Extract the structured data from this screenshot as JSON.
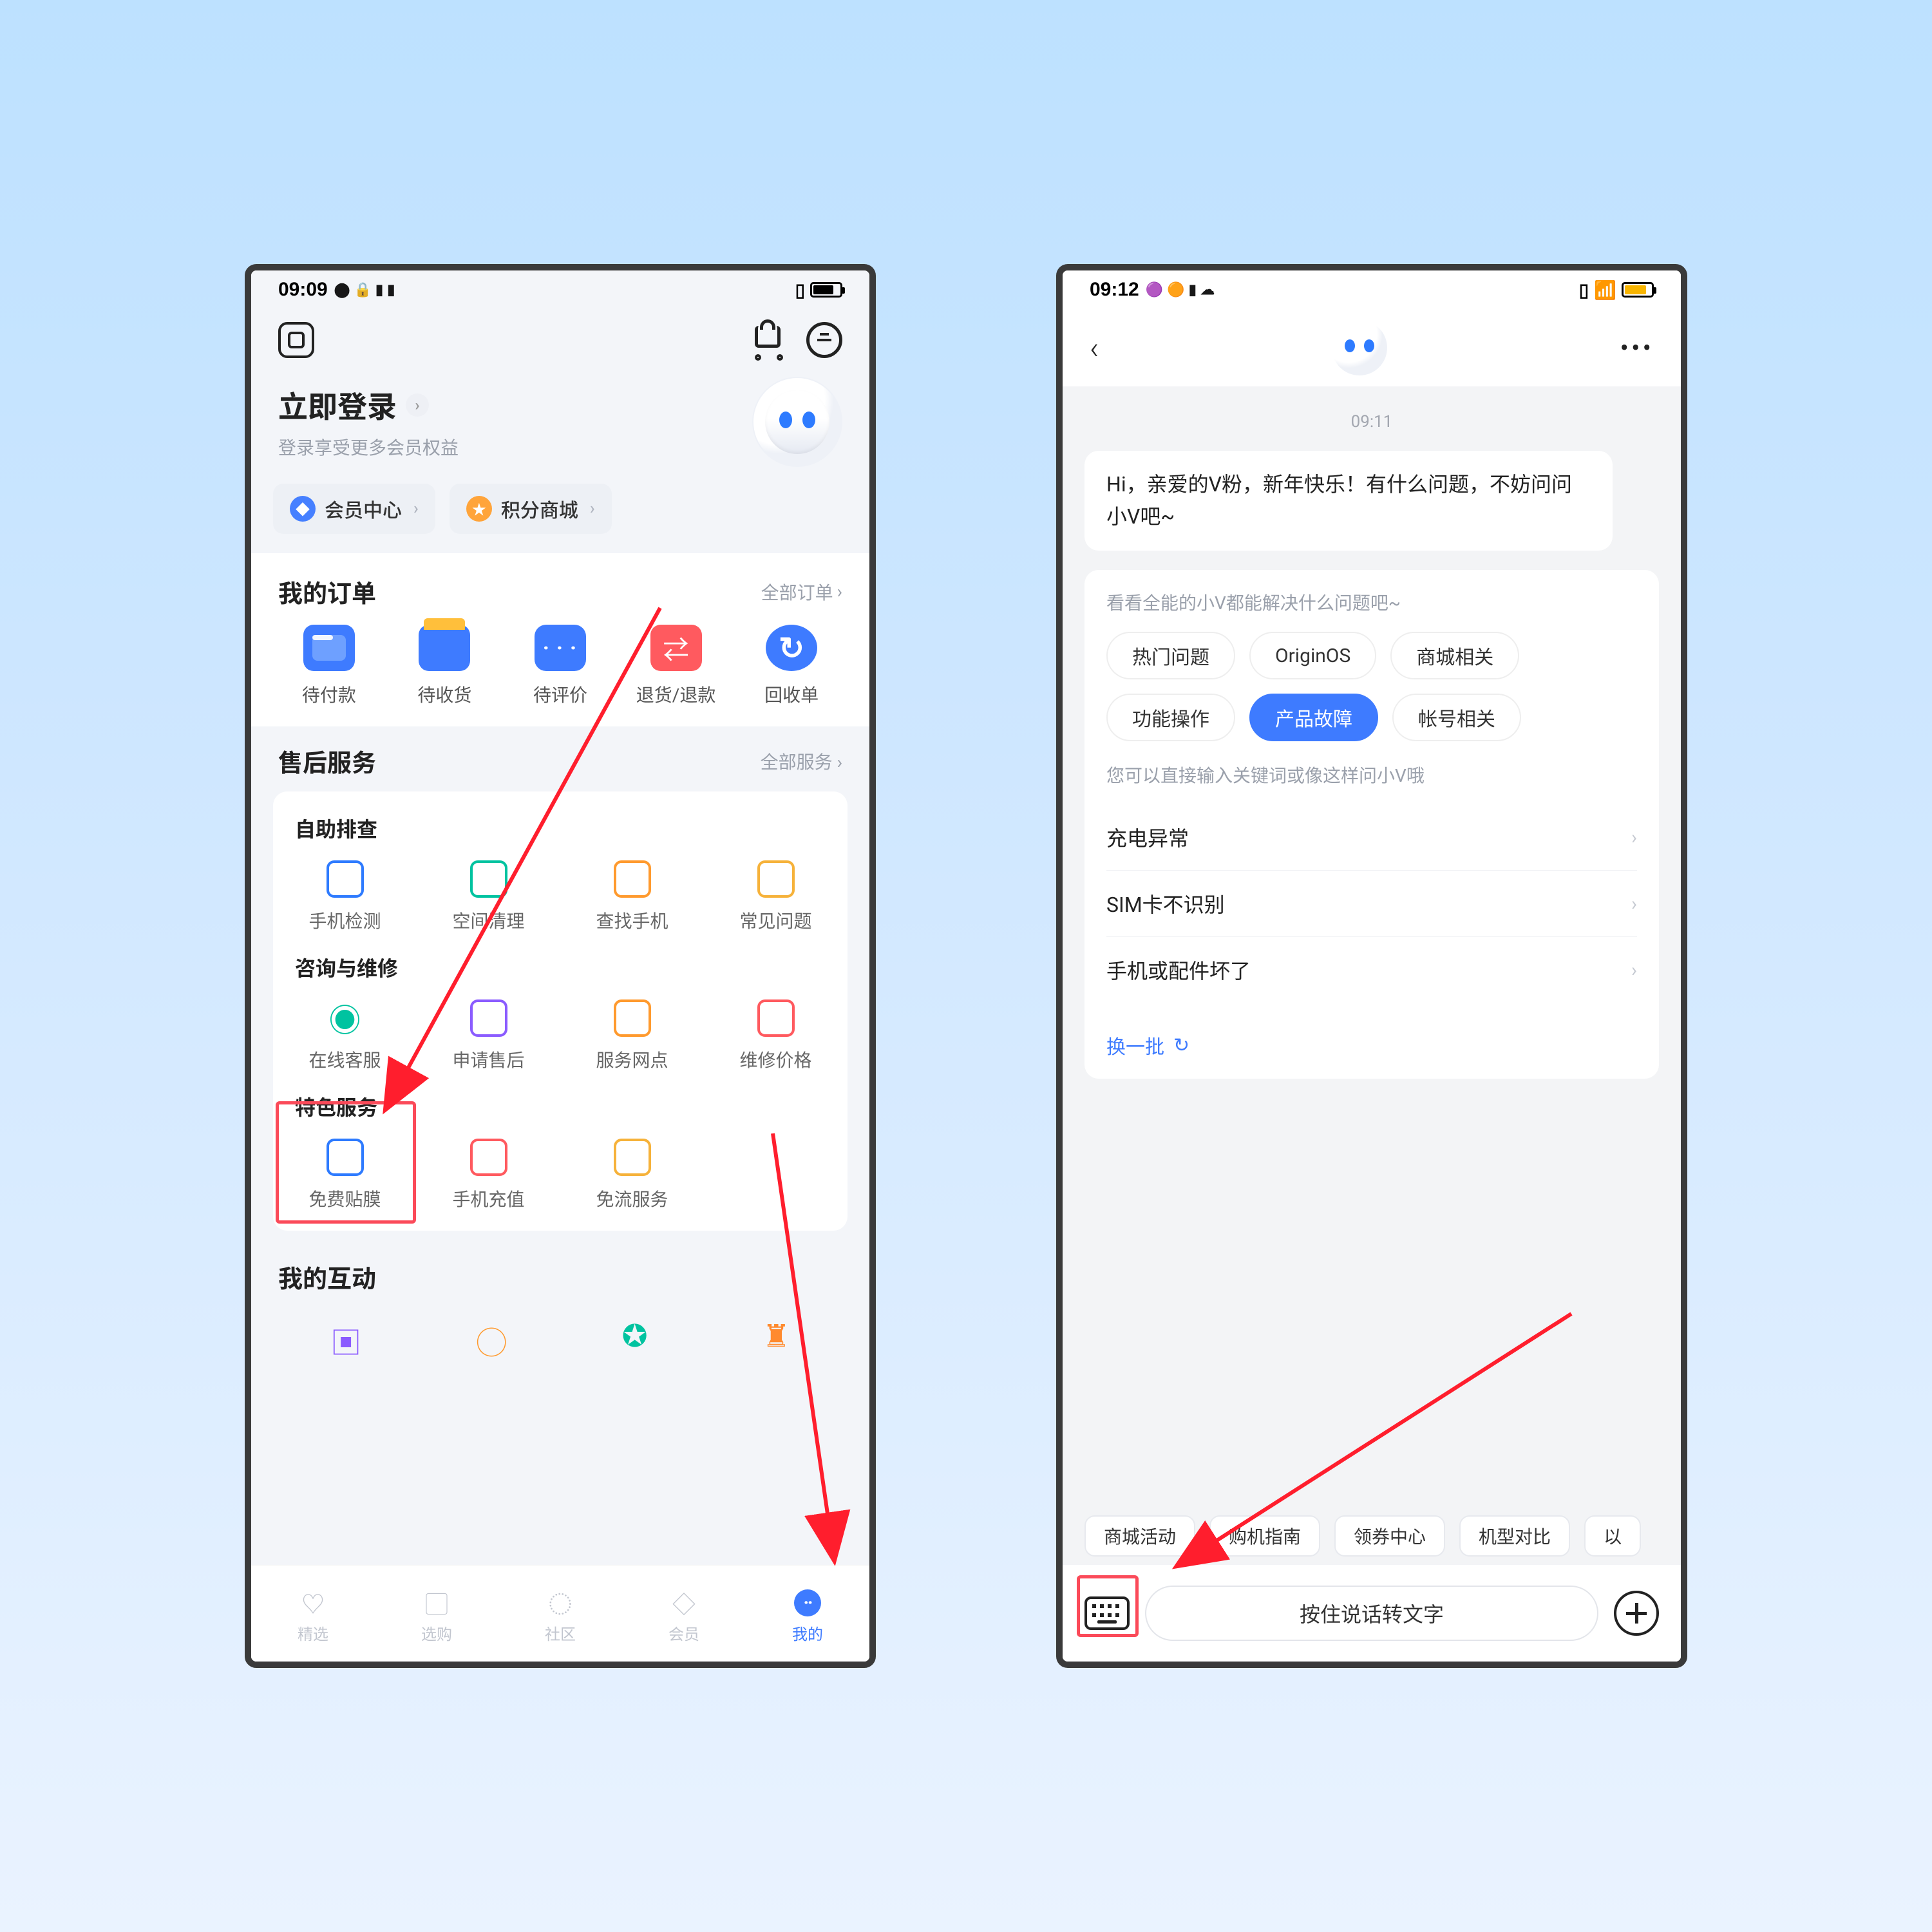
{
  "left": {
    "status": {
      "time": "09:09",
      "icons": "⬤ 🔒 ⬛ ⬛"
    },
    "login": {
      "title": "立即登录",
      "subtitle": "登录享受更多会员权益"
    },
    "chips": {
      "member": "会员中心",
      "points": "积分商城"
    },
    "orders": {
      "title": "我的订单",
      "all": "全部订单",
      "items": [
        "待付款",
        "待收货",
        "待评价",
        "退货/退款",
        "回收单"
      ]
    },
    "aftersale": {
      "title": "售后服务",
      "all": "全部服务"
    },
    "groups": {
      "self": {
        "title": "自助排查",
        "items": [
          "手机检测",
          "空间清理",
          "查找手机",
          "常见问题"
        ]
      },
      "consult": {
        "title": "咨询与维修",
        "items": [
          "在线客服",
          "申请售后",
          "服务网点",
          "维修价格"
        ]
      },
      "feature": {
        "title": "特色服务",
        "items": [
          "免费贴膜",
          "手机充值",
          "免流服务"
        ]
      }
    },
    "interact": "我的互动",
    "tabs": [
      "精选",
      "选购",
      "社区",
      "会员",
      "我的"
    ]
  },
  "right": {
    "status": {
      "time": "09:12",
      "icons": "🟣 🟠 ⬛ ☁️"
    },
    "timestamp": "09:11",
    "greeting": "Hi，亲爱的V粉，新年快乐！有什么问题，不妨问问小V吧~",
    "card": {
      "hint": "看看全能的小V都能解决什么问题吧~",
      "pills": [
        "热门问题",
        "OriginOS",
        "商城相关",
        "功能操作",
        "产品故障",
        "帐号相关"
      ],
      "activePill": "产品故障",
      "direct": "您可以直接输入关键词或像这样问小V哦",
      "qs": [
        "充电异常",
        "SIM卡不识别",
        "手机或配件坏了"
      ],
      "refresh": "换一批"
    },
    "quick": [
      "商城活动",
      "购机指南",
      "领券中心",
      "机型对比",
      "以"
    ],
    "voice": "按住说话转文字"
  }
}
